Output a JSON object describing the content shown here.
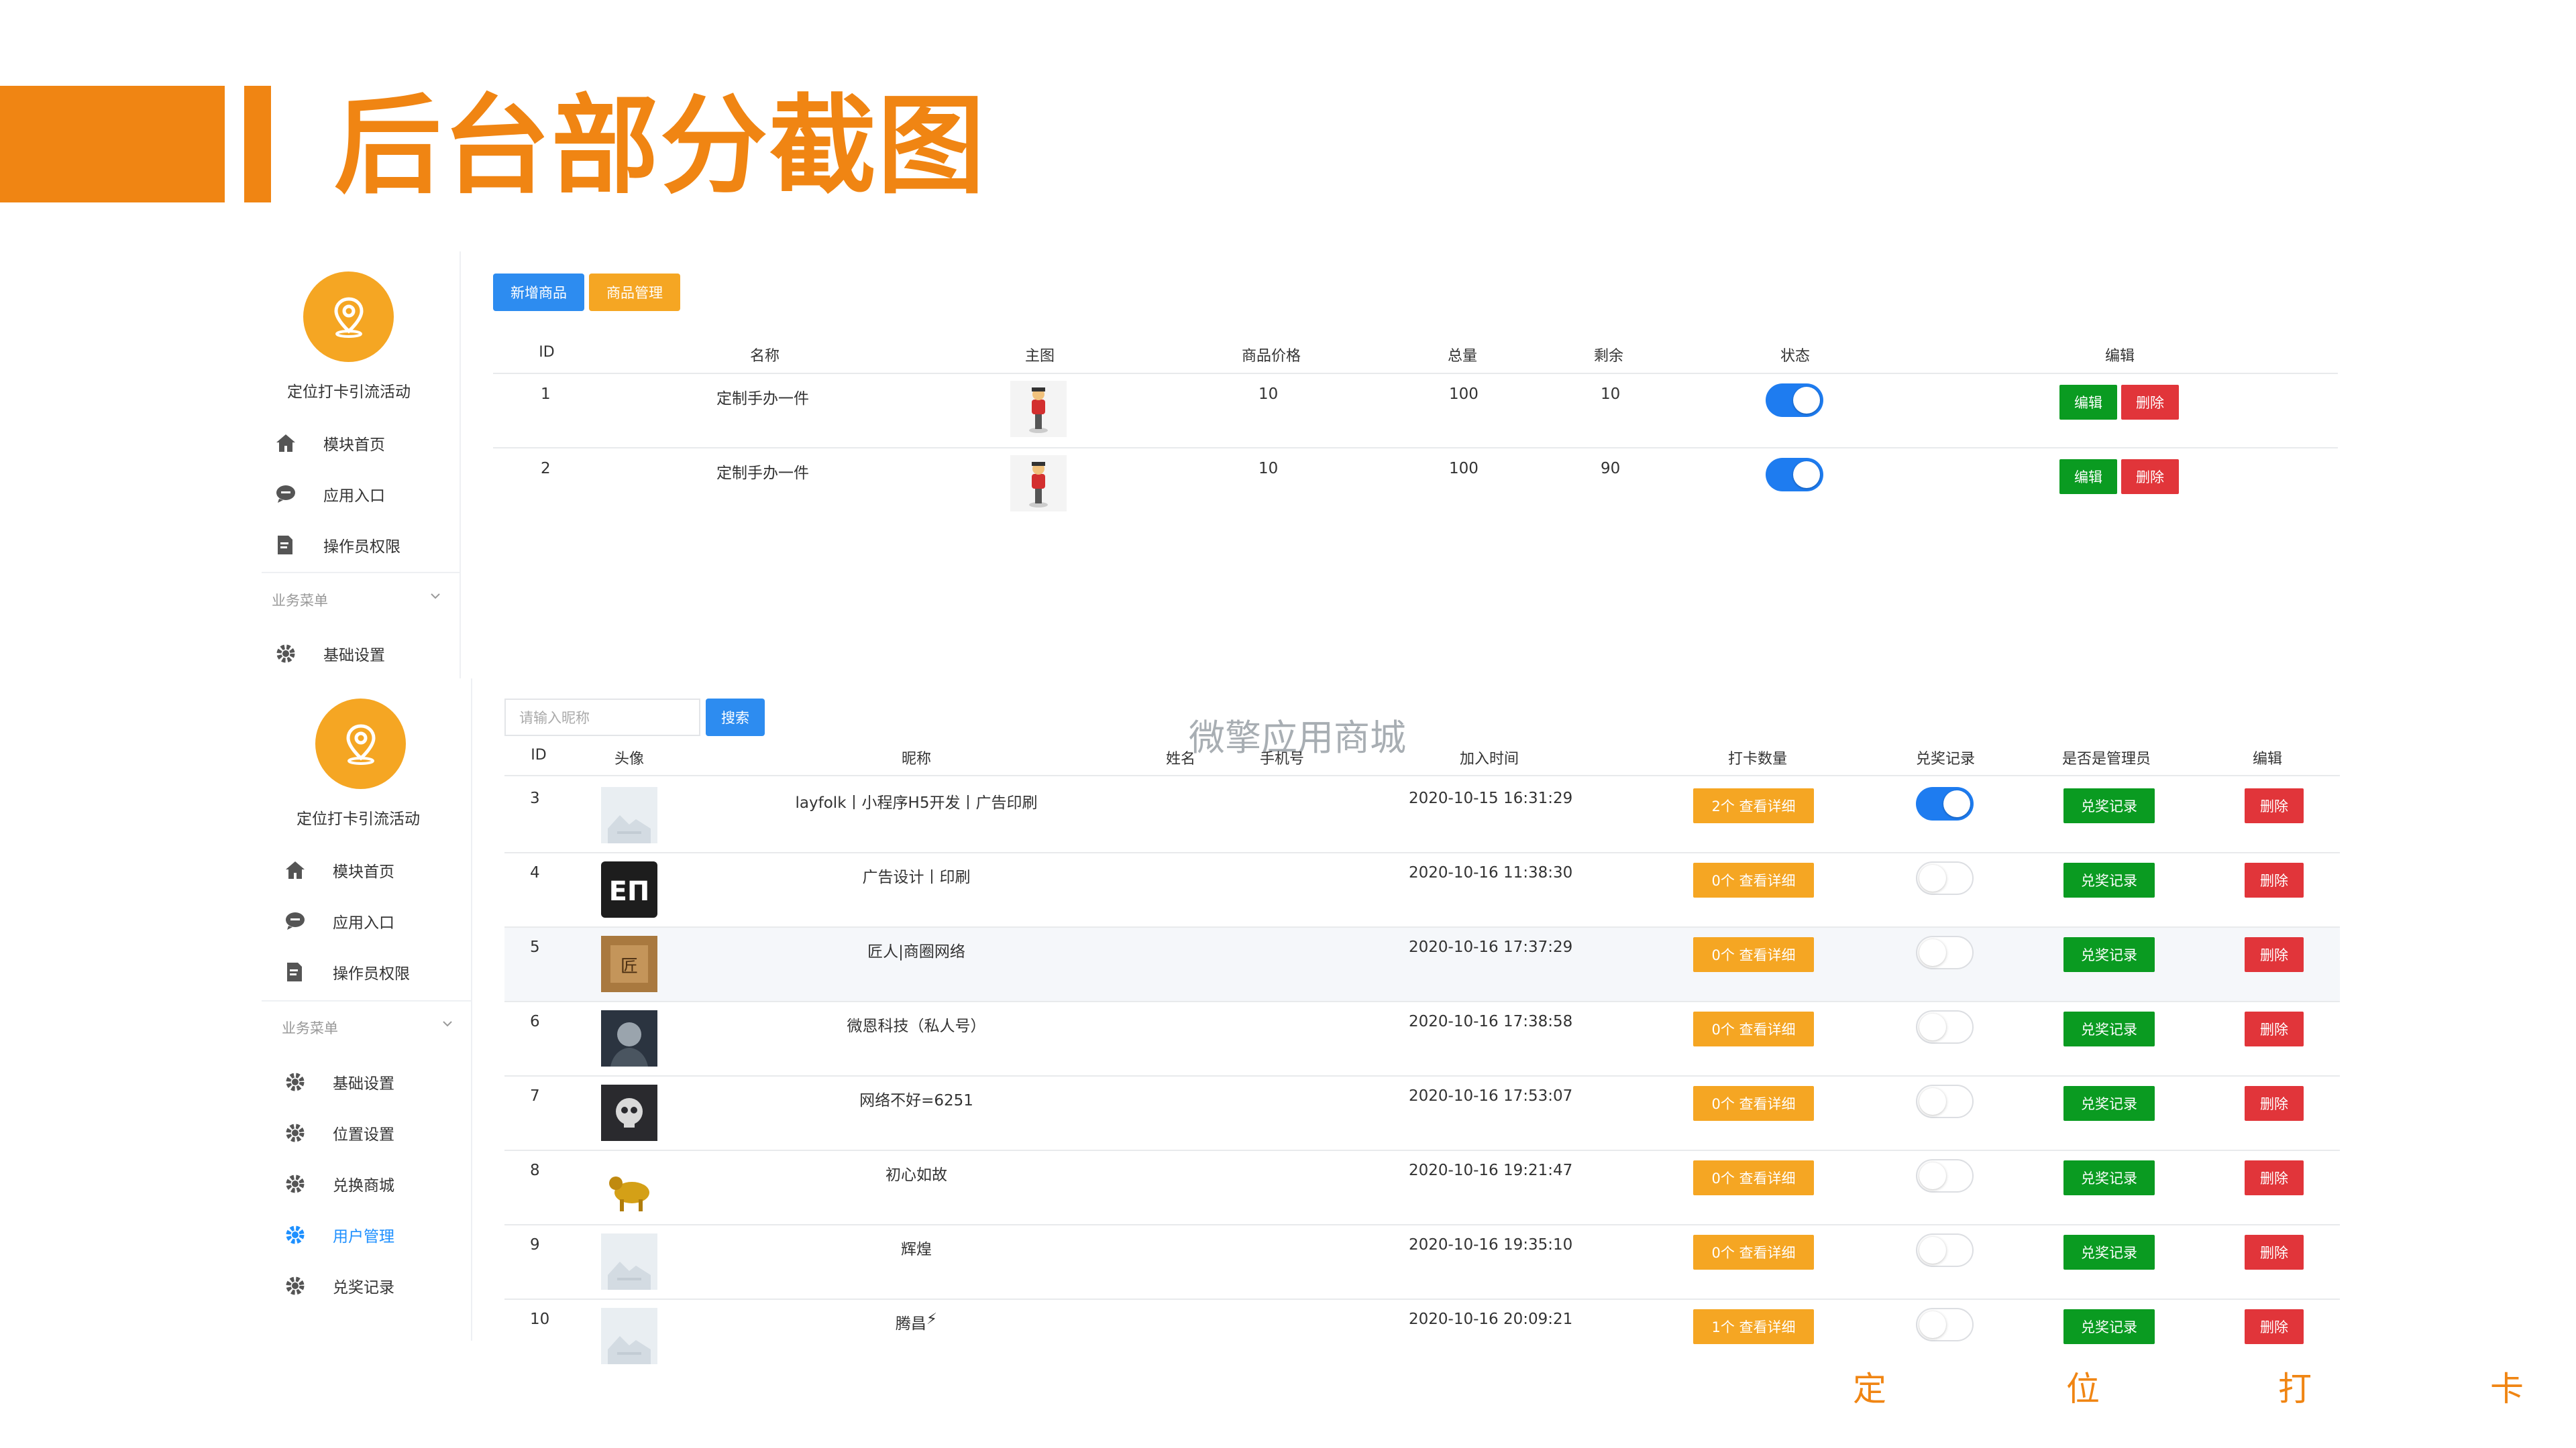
{
  "header": {
    "title": "后台部分截图"
  },
  "sidebar1": {
    "app_name": "定位打卡引流活动",
    "items": [
      "模块首页",
      "应用入口",
      "操作员权限"
    ],
    "group_label": "业务菜单",
    "group_items": [
      "基础设置"
    ]
  },
  "sidebar2": {
    "app_name": "定位打卡引流活动",
    "items": [
      "模块首页",
      "应用入口",
      "操作员权限"
    ],
    "group_label": "业务菜单",
    "group_items": [
      "基础设置",
      "位置设置",
      "兑换商城",
      "用户管理",
      "兑奖记录"
    ]
  },
  "goods": {
    "buttons": {
      "add": "新增商品",
      "manage": "商品管理"
    },
    "headers": [
      "ID",
      "名称",
      "主图",
      "商品价格",
      "总量",
      "剩余",
      "状态",
      "编辑"
    ],
    "rows": [
      {
        "id": "1",
        "name": "定制手办一件",
        "price": "10",
        "total": "100",
        "remain": "10",
        "status": true
      },
      {
        "id": "2",
        "name": "定制手办一件",
        "price": "10",
        "total": "100",
        "remain": "90",
        "status": true
      }
    ],
    "edit_label": "编辑",
    "delete_label": "删除"
  },
  "users": {
    "search_placeholder": "请输入昵称",
    "search_button": "搜索",
    "watermark": "微擎应用商城",
    "headers": [
      "ID",
      "头像",
      "昵称",
      "姓名",
      "手机号",
      "加入时间",
      "打卡数量",
      "兑奖记录",
      "是否是管理员",
      "编辑"
    ],
    "rows": [
      {
        "id": "3",
        "nickname": "layfolk丨小程序H5开发丨广告印刷",
        "time": "2020-10-15 16:31:29",
        "checkin": "2个 查看详细",
        "admin": true,
        "avatar": "placeholder"
      },
      {
        "id": "4",
        "nickname": "广告设计丨印刷",
        "time": "2020-10-16 11:38:30",
        "checkin": "0个 查看详细",
        "admin": false,
        "avatar": "en-logo"
      },
      {
        "id": "5",
        "nickname": "匠人|商圈网络",
        "time": "2020-10-16 17:37:29",
        "checkin": "0个 查看详细",
        "admin": false,
        "avatar": "brown"
      },
      {
        "id": "6",
        "nickname": "微恩科技（私人号）",
        "time": "2020-10-16 17:38:58",
        "checkin": "0个 查看详细",
        "admin": false,
        "avatar": "dark-portrait"
      },
      {
        "id": "7",
        "nickname": "网络不好=6251",
        "time": "2020-10-16 17:53:07",
        "checkin": "0个 查看详细",
        "admin": false,
        "avatar": "dark-skull"
      },
      {
        "id": "8",
        "nickname": "初心如故",
        "time": "2020-10-16 19:21:47",
        "checkin": "0个 查看详细",
        "admin": false,
        "avatar": "gold-bull"
      },
      {
        "id": "9",
        "nickname": "辉煌",
        "time": "2020-10-16 19:35:10",
        "checkin": "0个 查看详细",
        "admin": false,
        "avatar": "placeholder"
      },
      {
        "id": "10",
        "nickname": "腾昌",
        "time": "2020-10-16 20:09:21",
        "checkin": "1个 查看详细",
        "admin": false,
        "avatar": "placeholder"
      }
    ],
    "record_label": "兑奖记录",
    "delete_label": "删除"
  },
  "footer": {
    "chars": [
      "定",
      "位",
      "打",
      "卡"
    ]
  },
  "colors": {
    "accent": "#F08513",
    "blue": "#2D8CF0",
    "green": "#0A9B21",
    "red": "#E1353A",
    "orange": "#F5A623"
  }
}
